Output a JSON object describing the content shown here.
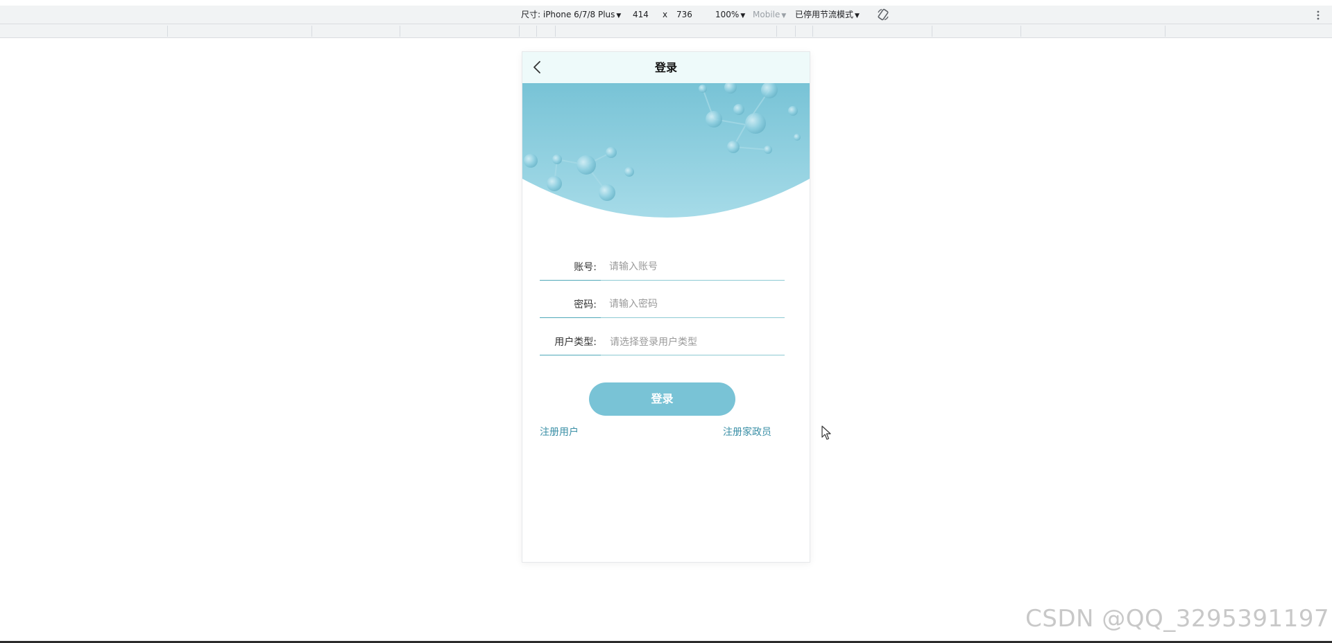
{
  "devtools": {
    "device_label": "尺寸: iPhone 6/7/8 Plus",
    "width": "414",
    "times": "x",
    "height": "736",
    "zoom": "100%",
    "mode": "Mobile",
    "throttle": "已停用节流模式",
    "icons": [
      "caret-down-icon",
      "rotate-icon",
      "more-vert-icon"
    ]
  },
  "page": {
    "title": "登录",
    "back_icon": "chevron-left-icon"
  },
  "form": {
    "account": {
      "label": "账号:",
      "placeholder": "请输入账号"
    },
    "password": {
      "label": "密码:",
      "placeholder": "请输入密码"
    },
    "user_type": {
      "label": "用户类型:",
      "placeholder": "请选择登录用户类型"
    }
  },
  "buttons": {
    "login": "登录"
  },
  "links": {
    "register_user": "注册用户",
    "register_housekeeper": "注册家政员"
  },
  "colors": {
    "accent": "#79c3d6",
    "link": "#3a8fa6",
    "nav_bg": "#eefafa",
    "underline": "#8cc9d3"
  },
  "watermark": "CSDN @QQ_3295391197"
}
